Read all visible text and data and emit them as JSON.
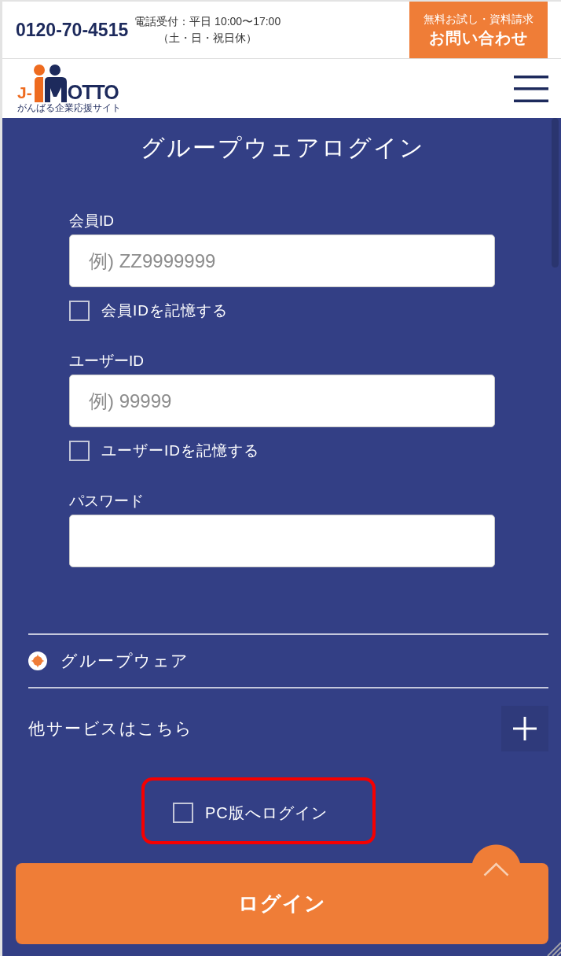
{
  "contact_bar": {
    "phone": "0120-70-4515",
    "hours": "電話受付：平日 10:00〜17:00",
    "hours_note": "（土・日・祝日休）",
    "cta": {
      "caption": "無料お試し・資料請求",
      "label": "お問い合わせ"
    }
  },
  "header": {
    "logo": {
      "prefix": "J-",
      "suffix": "OTTO",
      "tagline": "がんばる企業応援サイト"
    }
  },
  "login": {
    "title": "グループウェアログイン",
    "fields": [
      {
        "label": "会員ID",
        "placeholder": "例) ZZ9999999",
        "remember": {
          "label": "会員IDを記憶する",
          "checked": false
        }
      },
      {
        "label": "ユーザーID",
        "placeholder": "例) 99999",
        "remember": {
          "label": "ユーザーIDを記憶する",
          "checked": false
        }
      },
      {
        "label": "パスワード"
      }
    ],
    "services": [
      {
        "label": "グループウェア",
        "selected": true
      }
    ],
    "other_services": {
      "label": "他サービスはこちら",
      "expanded": false
    },
    "pc_login": {
      "label": "PC版へログイン",
      "checked": false,
      "highlighted": true
    },
    "submit": "ログイン"
  }
}
